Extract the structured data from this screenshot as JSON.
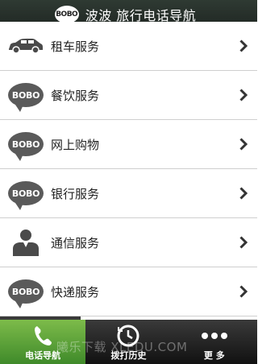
{
  "header": {
    "logo_text": "BOBO",
    "title": "波波 旅行电话导航"
  },
  "list": {
    "items": [
      {
        "label": "租车服务",
        "icon": "car-icon",
        "badge": ""
      },
      {
        "label": "餐饮服务",
        "icon": "bobo-bubble-icon",
        "badge": "BOBO"
      },
      {
        "label": "网上购物",
        "icon": "bobo-bubble-icon",
        "badge": "BOBO"
      },
      {
        "label": "银行服务",
        "icon": "bobo-bubble-icon",
        "badge": "BOBO"
      },
      {
        "label": "通信服务",
        "icon": "person-icon",
        "badge": ""
      },
      {
        "label": "快递服务",
        "icon": "bobo-bubble-icon",
        "badge": "BOBO"
      }
    ]
  },
  "tabbar": {
    "tabs": [
      {
        "label": "电话导航",
        "icon": "phone-icon",
        "active": true
      },
      {
        "label": "拨打历史",
        "icon": "clock-history-icon",
        "active": false
      },
      {
        "label": "更 多",
        "icon": "more-dots-icon",
        "active": false
      }
    ]
  },
  "watermark": "⁠曦乐下载 XLEDU.COM",
  "colors": {
    "header_bg": "#1f2622",
    "active_tab": "#5aa33a",
    "bubble": "#5a5a5a"
  }
}
